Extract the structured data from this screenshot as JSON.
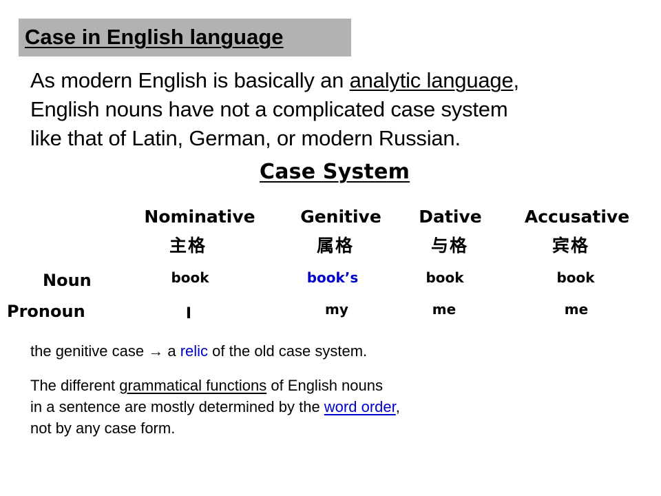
{
  "slide": {
    "title": "Case in English language",
    "intro": {
      "line1_before": "As modern English is basically an ",
      "line1_link": "analytic language",
      "line1_after": ",",
      "line2": "English nouns have not a complicated case system",
      "line3": "like that of Latin, German, or modern Russian."
    },
    "case_system": {
      "heading": "Case System",
      "columns": [
        {
          "name": "Nominative",
          "chinese": "主格"
        },
        {
          "name": "Genitive",
          "chinese": "属格"
        },
        {
          "name": "Dative",
          "chinese": "与格"
        },
        {
          "name": "Accusative",
          "chinese": "宾格"
        }
      ],
      "rows": [
        {
          "label": "Noun",
          "cells": [
            "book",
            "book’s",
            "book",
            "book"
          ]
        },
        {
          "label": "Pronoun",
          "cells": [
            "I",
            "my",
            "me",
            "me"
          ]
        }
      ],
      "highlight_color": "#0000cc"
    },
    "note": {
      "before": "the genitive case ",
      "arrow_icon": "→",
      "middle": " a ",
      "highlight": "relic",
      "after": " of the old case system."
    },
    "conclusion": {
      "line1_before": "The different ",
      "line1_underlined": "grammatical functions",
      "line1_after": " of English nouns",
      "line2_before": "in a sentence are mostly determined by the ",
      "line2_link": "word order",
      "line2_after": ",",
      "line3": "not by any case form."
    }
  }
}
